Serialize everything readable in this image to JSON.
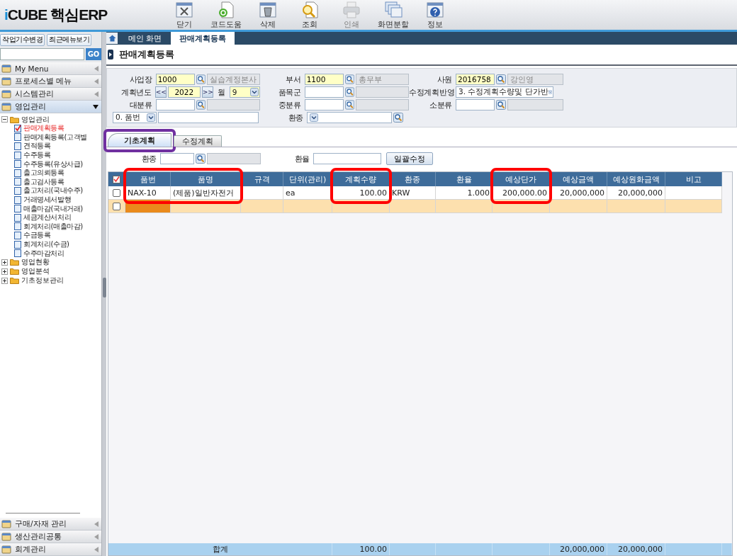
{
  "app": {
    "logo_mark": "i",
    "logo_text": "CUBE 핵심ERP"
  },
  "toolbar": [
    {
      "label": "닫기",
      "kind": "close",
      "disabled": false
    },
    {
      "label": "코드도움",
      "kind": "code",
      "disabled": false
    },
    {
      "label": "삭제",
      "kind": "delete",
      "disabled": false
    },
    {
      "label": "조회",
      "kind": "search",
      "disabled": false
    },
    {
      "label": "인쇄",
      "kind": "print",
      "disabled": true
    },
    {
      "label": "화면분할",
      "kind": "split",
      "disabled": false
    },
    {
      "label": "정보",
      "kind": "info",
      "disabled": false
    }
  ],
  "sidebar": {
    "buttons": [
      "작업기수변경",
      "최근메뉴보기"
    ],
    "search_button": "GO",
    "sections_top": [
      {
        "label": "My Menu",
        "expanded": false
      },
      {
        "label": "프로세스별 메뉴",
        "expanded": false
      },
      {
        "label": "시스템관리",
        "expanded": false
      },
      {
        "label": "영업관리",
        "expanded": true
      }
    ],
    "tree": [
      {
        "label": "영업관리",
        "expanded": true,
        "children": [
          {
            "label": "판매계획등록",
            "selected": true
          },
          {
            "label": "판매계획등록(고객별",
            "selected": false
          },
          {
            "label": "견적등록",
            "selected": false
          },
          {
            "label": "수주등록",
            "selected": false
          },
          {
            "label": "수주등록(유상사급)",
            "selected": false
          },
          {
            "label": "출고의뢰등록",
            "selected": false
          },
          {
            "label": "출고검사등록",
            "selected": false
          },
          {
            "label": "출고처리(국내수주)",
            "selected": false
          },
          {
            "label": "거래명세서발행",
            "selected": false
          },
          {
            "label": "매출마감(국내거래)",
            "selected": false
          },
          {
            "label": "세금계산서처리",
            "selected": false
          },
          {
            "label": "회계처리(매출마감)",
            "selected": false
          },
          {
            "label": "수금등록",
            "selected": false
          },
          {
            "label": "회계처리(수금)",
            "selected": false
          },
          {
            "label": "수주마감처리",
            "selected": false
          }
        ]
      },
      {
        "label": "영업현황",
        "expanded": false
      },
      {
        "label": "영업분석",
        "expanded": false
      },
      {
        "label": "기초정보관리",
        "expanded": false
      }
    ],
    "sections_bottom": [
      {
        "label": "구매/자재 관리",
        "expanded": false
      },
      {
        "label": "생산관리공통",
        "expanded": false
      },
      {
        "label": "회계관리",
        "expanded": false
      }
    ]
  },
  "tabs": [
    {
      "label": "메인 화면",
      "selected": false
    },
    {
      "label": "판매계획등록",
      "selected": true
    }
  ],
  "page_title": "판매계획등록",
  "form": [
    {
      "label": "사업장",
      "kind": "code",
      "value": "1000",
      "name": "실습계정본사",
      "required": true
    },
    {
      "label": "부서",
      "kind": "code",
      "value": "1100",
      "name": "총무부",
      "required": true
    },
    {
      "label": "사원",
      "kind": "code",
      "value": "2016758",
      "name": "강인영",
      "required": true
    },
    {
      "label": "계획년도",
      "kind": "year",
      "prev": "<<",
      "value": "2022",
      "next": ">>",
      "month_label": "월",
      "month": "9",
      "required": true
    },
    {
      "label": "품목군",
      "kind": "code",
      "required": false
    },
    {
      "label": "수정계획반영",
      "kind": "select",
      "value": "3. 수정계획수량및 단가반",
      "required": false
    },
    {
      "label": "대분류",
      "kind": "code",
      "required": false
    },
    {
      "label": "중분류",
      "kind": "code",
      "required": false
    },
    {
      "label": "소분류",
      "kind": "code",
      "required": false
    },
    {
      "kind": "prefix",
      "value": "0. 품번",
      "required": false
    },
    {
      "label": "환종",
      "kind": "select-search",
      "required": false
    }
  ],
  "sub_tabs": [
    {
      "label": "기초계획",
      "selected": true,
      "highlighted": true
    },
    {
      "label": "수정계획",
      "selected": false,
      "highlighted": false
    }
  ],
  "sub_form": {
    "currency_label": "환종",
    "rate_label": "환율",
    "apply_button": "일괄수정"
  },
  "table": {
    "columns": [
      {
        "label": "품번",
        "kind": "text",
        "highlighted": true
      },
      {
        "label": "품명",
        "kind": "text",
        "highlighted": true
      },
      {
        "label": "규격",
        "kind": "text",
        "highlighted": false
      },
      {
        "label": "단위(관리)",
        "kind": "text",
        "highlighted": false
      },
      {
        "label": "계획수량",
        "kind": "number",
        "highlighted": true,
        "total": "100.00"
      },
      {
        "label": "환종",
        "kind": "text",
        "highlighted": false
      },
      {
        "label": "환율",
        "kind": "number",
        "highlighted": false
      },
      {
        "label": "예상단가",
        "kind": "number",
        "highlighted": true
      },
      {
        "label": "예상금액",
        "kind": "number",
        "highlighted": false,
        "total": "20,000,000"
      },
      {
        "label": "예상원화금액",
        "kind": "number",
        "highlighted": false,
        "total": "20,000,000"
      },
      {
        "label": "비고",
        "kind": "text",
        "highlighted": false
      }
    ],
    "rows": [
      {
        "kind": "data",
        "checked": false,
        "cells": [
          "NAX-10",
          "(제품)일반자전거",
          "",
          "ea",
          "100.00",
          "KRW",
          "1.000",
          "200,000.00",
          "20,000,000",
          "20,000,000",
          ""
        ]
      },
      {
        "kind": "new",
        "checked": false
      }
    ],
    "total_label": "합계",
    "select_all_checked": true
  }
}
